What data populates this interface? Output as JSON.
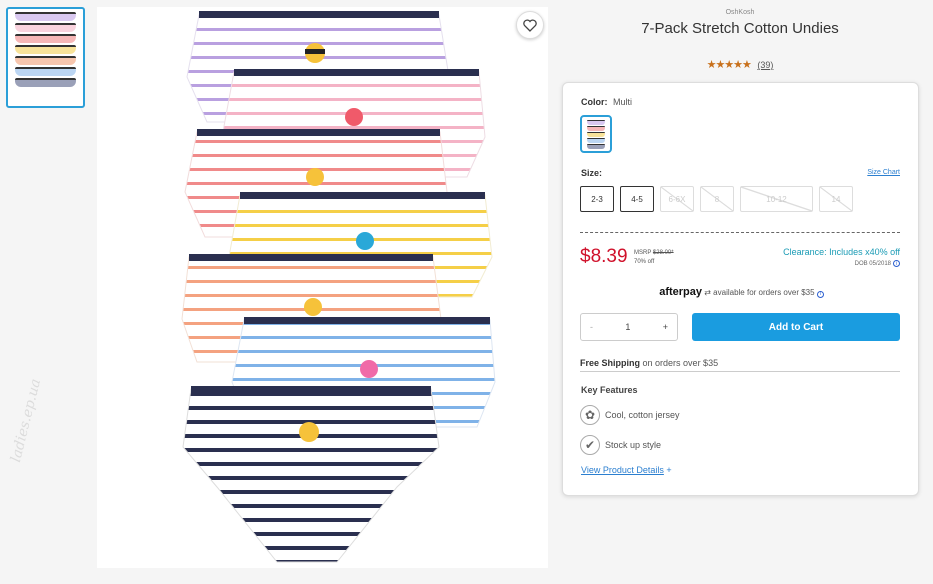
{
  "colors": {
    "accent": "#2b9fd8",
    "price_red": "#d0112b",
    "clearance_teal": "#1a9bb5",
    "cart_blue": "#1a9ce0",
    "stars": "#c8701b"
  },
  "gallery": {
    "thumbnails": [
      {
        "alt": "product thumbnail"
      }
    ],
    "watermark": "ladies.ep.ua",
    "stripes": [
      "#b9a0e0",
      "#f4b3c6",
      "#f08a8a",
      "#f5cf47",
      "#f4a280",
      "#7fb2e8",
      "#2a2f4f"
    ]
  },
  "product": {
    "brand": "OshKosh",
    "title": "7-Pack Stretch Cotton Undies",
    "stars": "★★★★★",
    "review_count": "(39)"
  },
  "color": {
    "label": "Color:",
    "value": "Multi"
  },
  "size": {
    "label": "Size:",
    "chart_link": "Size Chart",
    "options": [
      {
        "label": "2-3",
        "available": true
      },
      {
        "label": "4-5",
        "available": true
      },
      {
        "label": "6-6X",
        "available": false
      },
      {
        "label": "8",
        "available": false
      },
      {
        "label": "10-12",
        "available": false
      },
      {
        "label": "14",
        "available": false
      }
    ]
  },
  "pricing": {
    "price": "$8.39",
    "msrp_label": "MSRP",
    "msrp_value": "$28.00*",
    "discount": "70% off",
    "clearance": "Clearance: Includes x40% off",
    "dob": "DOB 05/2018"
  },
  "afterpay": {
    "logo": "afterpay",
    "text": "available for orders over $35"
  },
  "quantity": {
    "minus": "-",
    "value": "1",
    "plus": "+"
  },
  "cart": {
    "add_label": "Add to Cart"
  },
  "shipping": {
    "bold": "Free Shipping",
    "rest": "on orders over $35"
  },
  "features": {
    "title": "Key Features",
    "items": [
      {
        "icon": "cotton-icon",
        "label": "Cool, cotton jersey"
      },
      {
        "icon": "checkmark-icon",
        "label": "Stock up style"
      }
    ],
    "details_link": "View Product Details",
    "details_plus": "+"
  }
}
